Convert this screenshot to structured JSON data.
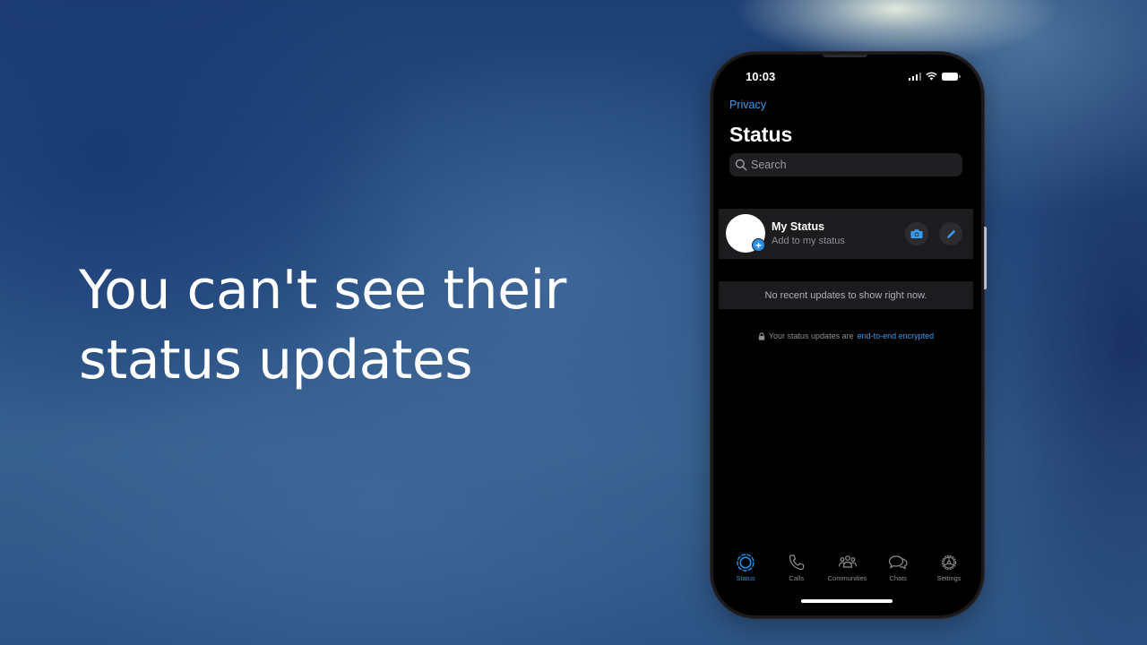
{
  "headline": {
    "line1": "You can't see their",
    "line2": "status updates"
  },
  "phone": {
    "status_bar": {
      "time": "10:03",
      "icons": [
        "cellular-signal-icon",
        "wifi-icon",
        "battery-icon"
      ]
    },
    "nav": {
      "back_label": "Privacy",
      "title": "Status"
    },
    "search": {
      "placeholder": "Search"
    },
    "my_status": {
      "name": "My Status",
      "subtitle": "Add to my status",
      "actions": [
        "camera-icon",
        "pencil-icon"
      ]
    },
    "empty_message": "No recent updates to show right now.",
    "encryption_note": {
      "prefix": "Your status updates are",
      "link": "end-to-end encrypted"
    },
    "tabs": [
      {
        "label": "Status",
        "icon": "status-icon",
        "active": true
      },
      {
        "label": "Calls",
        "icon": "phone-icon",
        "active": false
      },
      {
        "label": "Communities",
        "icon": "communities-icon",
        "active": false
      },
      {
        "label": "Chats",
        "icon": "chats-icon",
        "active": false
      },
      {
        "label": "Settings",
        "icon": "gear-icon",
        "active": false
      }
    ]
  },
  "colors": {
    "accent": "#2a8fe6",
    "link": "#3a9cf0",
    "screen_bg": "#000000",
    "cell_bg": "#1c1c1e"
  }
}
